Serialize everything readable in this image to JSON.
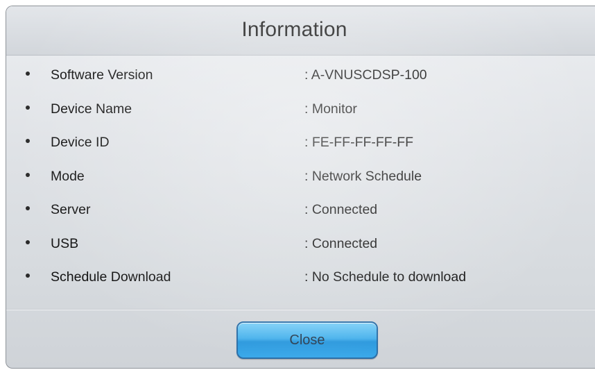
{
  "dialog": {
    "title": "Information",
    "items": [
      {
        "label": "Software Version",
        "value": ": A-VNUSCDSP-100"
      },
      {
        "label": "Device Name",
        "value": ": Monitor"
      },
      {
        "label": "Device ID",
        "value": ": FE-FF-FF-FF-FF"
      },
      {
        "label": "Mode",
        "value": ": Network Schedule"
      },
      {
        "label": "Server",
        "value": ": Connected"
      },
      {
        "label": "USB",
        "value": ": Connected"
      },
      {
        "label": "Schedule Download",
        "value": ": No Schedule to download"
      }
    ],
    "close_label": "Close"
  },
  "colors": {
    "button_top": "#7fd0f7",
    "button_bottom": "#2b98dd",
    "button_border": "#2b6fa8",
    "panel_background": "#dfe2e6"
  }
}
